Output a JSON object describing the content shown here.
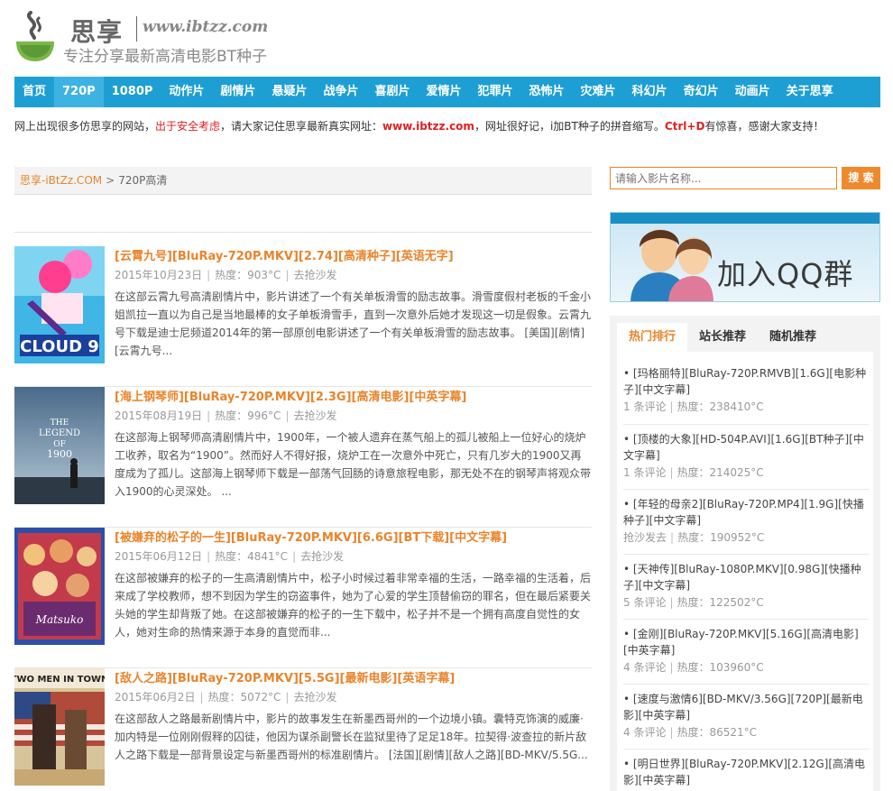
{
  "site": {
    "name": "思享",
    "url": "www.ibtzz.com",
    "slogan": "专注分享最新高清电影BT种子"
  },
  "nav": [
    "首页",
    "720P",
    "1080P",
    "动作片",
    "剧情片",
    "悬疑片",
    "战争片",
    "喜剧片",
    "爱情片",
    "犯罪片",
    "恐怖片",
    "灾难片",
    "科幻片",
    "奇幻片",
    "动画片",
    "关于思享"
  ],
  "nav_active": "720P",
  "notice": {
    "part1": "网上出现很多仿思享的网站，",
    "part2": "出于安全考虑",
    "part3": "，请大家记住思享最新真实网址：",
    "part4": "www.ibtzz.com",
    "part5": "，网址很好记，i加BT种子的拼音缩写。",
    "part6": "Ctrl+D",
    "part7": "有惊喜，感谢大家支持！"
  },
  "breadcrumb": {
    "home": "思享-iBtZz.COM",
    "sep": ">",
    "current": "720P高清"
  },
  "posts": [
    {
      "title": "[云霄九号][BluRay-720P.MKV][2.74][高清种子][英语无字]",
      "date": "2015年10月23日",
      "heat": "热度：903°C",
      "comment": "去抢沙发",
      "excerpt": "在这部云霄九号高清剧情片中，影片讲述了一个有关单板滑雪的励志故事。滑雪度假村老板的千金小姐凯拉一直以为自己是当地最棒的女子单板滑雪手，直到一次意外后她才发现这一切是假象。云霄九号下载是迪士尼频道2014年的第一部原创电影讲述了一个有关单板滑雪的励志故事。 [美国][剧情][云霄九号..."
    },
    {
      "title": "[海上钢琴师][BluRay-720P.MKV][2.3G][高清电影][中英字幕]",
      "date": "2015年08月19日",
      "heat": "热度：996°C",
      "comment": "去抢沙发",
      "excerpt": "在这部海上钢琴师高清剧情片中，1900年，一个被人遗弃在蒸气船上的孤儿被船上一位好心的烧炉工收养，取名为“1900”。然而好人不得好报，烧炉工在一次意外中死亡，只有几岁大的1900又再度成为了孤儿。这部海上钢琴师下载是一部荡气回肠的诗意旅程电影，那无处不在的钢琴声将观众带入1900的心灵深处。 ..."
    },
    {
      "title": "[被嫌弃的松子的一生][BluRay-720P.MKV][6.6G][BT下载][中文字幕]",
      "date": "2015年06月12日",
      "heat": "热度：4841°C",
      "comment": "去抢沙发",
      "excerpt": "在这部被嫌弃的松子的一生高清剧情片中，松子小时候过着非常幸福的生活，一路幸福的生活着，后来成了学校教师，想不到因为学生的窃盗事件，她为了心爱的学生顶替偷窃的罪名，但在最后紧要关头她的学生却背叛了她。在这部被嫌弃的松子的一生下载中，松子并不是一个拥有高度自觉性的女人，她对生命的热情来源于本身的直觉而非..."
    },
    {
      "title": "[敌人之路][BluRay-720P.MKV][5.5G][最新电影][英语字幕]",
      "date": "2015年06月2日",
      "heat": "热度：5072°C",
      "comment": "去抢沙发",
      "excerpt": "在这部敌人之路最新剧情片中，影片的故事发生在新墨西哥州的一个边境小镇。囊特克饰演的威廉·加内特是一位刚刚假释的囚徒，他因为谋杀副警长在监狱里待了足足18年。拉契得·波查拉的新片敌人之路下载是一部背景设定与新墨西哥州的标准剧情片。 [法国][剧情][敌人之路][BD-MKV/5.5G..."
    }
  ],
  "search": {
    "placeholder": "请输入影片名称...",
    "button": "搜 索"
  },
  "qq_banner": "加入QQ群",
  "sidebar": {
    "tabs": [
      "热门排行",
      "站长推荐",
      "随机推荐"
    ],
    "active_tab": "热门排行",
    "items": [
      {
        "title": "• [玛格丽特][BluRay-720P.RMVB][1.6G][电影种子][中文字幕]",
        "comments": "1 条评论",
        "heat": "热度：238410°C"
      },
      {
        "title": "• [顶楼的大象][HD-504P.AVI][1.6G][BT种子][中文字幕]",
        "comments": "1 条评论",
        "heat": "热度：214025°C"
      },
      {
        "title": "• [年轻的母亲2][BluRay-720P.MP4][1.9G][快播种子][中文字幕]",
        "comments": "抢沙发去",
        "heat": "热度：190952°C"
      },
      {
        "title": "• [天神传][BluRay-1080P.MKV][0.98G][快播种子][中文字幕]",
        "comments": "5 条评论",
        "heat": "热度：122502°C"
      },
      {
        "title": "• [金刚][BluRay-720P.MKV][5.16G][高清电影][中英字幕]",
        "comments": "4 条评论",
        "heat": "热度：103960°C"
      },
      {
        "title": "• [速度与激情6][BD-MKV/3.56G][720P][最新电影][中英字幕]",
        "comments": "4 条评论",
        "heat": "热度：86521°C"
      },
      {
        "title": "• [明日世界][BluRay-720P.MKV][2.12G][高清电影][中英字幕]",
        "comments": "",
        "heat": ""
      }
    ]
  },
  "colors": {
    "nav": "#1d9fd3",
    "accent": "#e9842b",
    "notice_red": "#e02020"
  }
}
